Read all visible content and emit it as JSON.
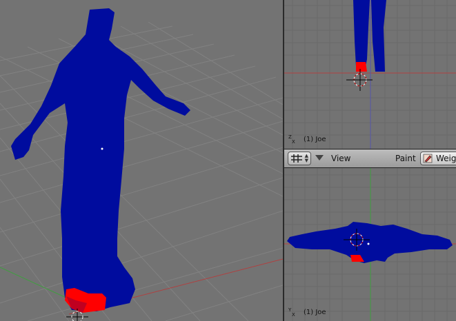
{
  "viewports": {
    "top_right": {
      "object_label": "(1) Joe",
      "axis_labels": [
        "Z",
        "X"
      ]
    },
    "bottom_right": {
      "object_label": "(1) Joe",
      "axis_labels": [
        "Y",
        "X"
      ]
    }
  },
  "header": {
    "view_menu": "View",
    "mode_label": "Paint",
    "weight_button": "Weig"
  },
  "colors": {
    "background": "#737373",
    "grid": "#6b6b6b",
    "x_axis": "#b04040",
    "y_axis": "#3f9f3f",
    "mesh": "#000c9e",
    "weight": "#ff0000"
  }
}
